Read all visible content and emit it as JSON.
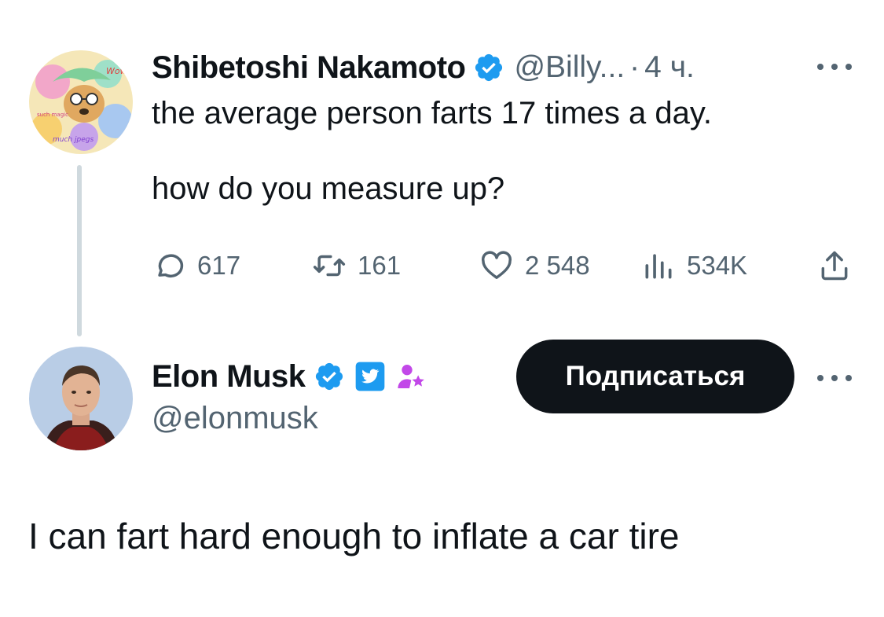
{
  "tweet": {
    "author_name": "Shibetoshi Nakamoto",
    "author_handle": "@Billy...",
    "separator": "·",
    "time": "4 ч.",
    "text": "the average person farts 17 times a day.\n\nhow do you measure up?",
    "avatar_labels": {
      "wow": "Wow",
      "much_jpegs": "much jpegs",
      "such_magic": "such magic"
    },
    "stats": {
      "replies": "617",
      "retweets": "161",
      "likes": "2 548",
      "views": "534K"
    }
  },
  "reply": {
    "author_name": "Elon Musk",
    "author_handle": "@elonmusk",
    "follow_label": "Подписаться",
    "text": "I can fart hard enough to inflate a car tire"
  },
  "colors": {
    "verified_blue": "#1d9bf0",
    "affiliate_purple": "#c248e8",
    "text_primary": "#0f1419",
    "text_secondary": "#536471",
    "thread_line": "#cfd9de"
  },
  "icons": [
    "verified-badge-icon",
    "more-options-icon",
    "reply-icon",
    "retweet-icon",
    "like-icon",
    "views-icon",
    "share-icon",
    "twitter-bird-icon",
    "affiliate-person-icon"
  ]
}
